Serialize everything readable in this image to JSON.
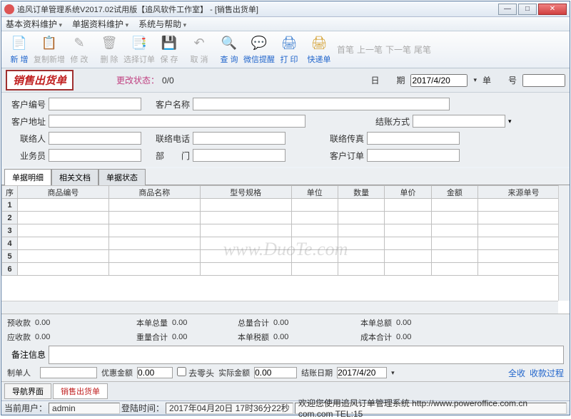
{
  "window": {
    "title": "追风订单管理系统V2017.02试用版【追风软件工作室】 - [销售出货单]"
  },
  "menu": {
    "m1": "基本资料维护",
    "m2": "单据资料维护",
    "m3": "系统与帮助"
  },
  "toolbar": {
    "new": "新 增",
    "copy": "复制新增",
    "edit": "修 改",
    "delete": "删 除",
    "select": "选择订单",
    "save": "保 存",
    "cancel": "取 消",
    "query": "查 询",
    "wechat": "微信提醒",
    "print": "打 印",
    "express": "快递单",
    "first": "首笔",
    "prev": "上一笔",
    "next": "下一笔",
    "last": "尾笔"
  },
  "header": {
    "docname": "销售出货单",
    "status_lbl": "更改状态：",
    "status_val": "0/0",
    "date_lbl": "日　　期",
    "date_val": "2017/4/20",
    "no_lbl": "单　　号",
    "no_val": ""
  },
  "form": {
    "custno": "客户编号",
    "custname": "客户名称",
    "addr": "客户地址",
    "paytype": "结账方式",
    "contact": "联络人",
    "phone": "联络电话",
    "fax": "联络传真",
    "sales": "业务员",
    "dept": "部　　门",
    "custorder": "客户订单"
  },
  "tabs": {
    "t1": "单据明细",
    "t2": "相关文档",
    "t3": "单据状态"
  },
  "grid": {
    "cols": [
      "序",
      "商品编号",
      "商品名称",
      "型号规格",
      "单位",
      "数量",
      "单价",
      "金额",
      "来源单号"
    ],
    "rows": [
      "1",
      "2",
      "3",
      "4",
      "5",
      "6"
    ]
  },
  "totals": {
    "prepay": "预收款",
    "prepay_v": "0.00",
    "qty": "本单总量",
    "qty_v": "0.00",
    "qtysum": "总量合计",
    "qtysum_v": "0.00",
    "amt": "本单总额",
    "amt_v": "0.00",
    "due": "应收款",
    "due_v": "0.00",
    "wsum": "重量合计",
    "wsum_v": "0.00",
    "tax": "本单税额",
    "tax_v": "0.00",
    "cost": "成本合计",
    "cost_v": "0.00",
    "memo": "备注信息",
    "maker": "制单人",
    "disc": "优惠金额",
    "disc_v": "0.00",
    "round": "去零头",
    "real": "实际金额",
    "real_v": "0.00",
    "paydate": "结账日期",
    "paydate_v": "2017/4/20",
    "full": "全收",
    "proc": "收款过程"
  },
  "bottomtabs": {
    "b1": "导航界面",
    "b2": "销售出货单"
  },
  "status": {
    "user_lbl": "当前用户：",
    "user": "admin",
    "login_lbl": "登陆时间：",
    "login": "2017年04月20日 17时36分22秒",
    "welcome": "欢迎您使用追风订单管理系统 http://www.poweroffice.com.cn com.com TEL:15"
  },
  "watermark": "www.DuoTe.com"
}
